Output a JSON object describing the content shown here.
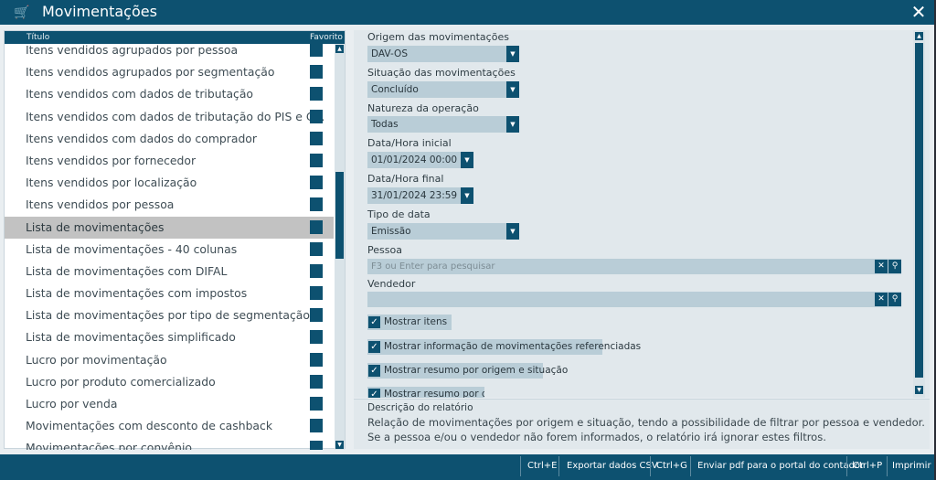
{
  "window": {
    "title": "Movimentações",
    "close_glyph": "✕",
    "logo_glyph": "🛒"
  },
  "list": {
    "header_title": "Título",
    "header_favorite": "Favorito",
    "items": [
      {
        "label": "Itens vendidos agrupados por pessoa"
      },
      {
        "label": "Itens vendidos agrupados por segmentação"
      },
      {
        "label": "Itens vendidos com dados de tributação"
      },
      {
        "label": "Itens vendidos com dados de tributação do PIS e C..."
      },
      {
        "label": "Itens vendidos com dados do comprador"
      },
      {
        "label": "Itens vendidos por fornecedor"
      },
      {
        "label": "Itens vendidos por localização"
      },
      {
        "label": "Itens vendidos por pessoa"
      },
      {
        "label": "Lista de movimentações",
        "selected": true
      },
      {
        "label": "Lista de movimentações - 40 colunas"
      },
      {
        "label": "Lista de movimentações com DIFAL"
      },
      {
        "label": "Lista de movimentações com impostos"
      },
      {
        "label": "Lista de movimentações por tipo de segmentação"
      },
      {
        "label": "Lista de movimentações simplificado"
      },
      {
        "label": "Lucro por movimentação"
      },
      {
        "label": "Lucro por produto comercializado"
      },
      {
        "label": "Lucro por venda"
      },
      {
        "label": "Movimentações com desconto de cashback"
      },
      {
        "label": "Movimentações por convênio"
      }
    ]
  },
  "filters": {
    "origem": {
      "label": "Origem das movimentações",
      "value": "DAV-OS"
    },
    "situacao": {
      "label": "Situação das movimentações",
      "value": "Concluído"
    },
    "natureza": {
      "label": "Natureza da operação",
      "value": "Todas"
    },
    "data_inicial": {
      "label": "Data/Hora inicial",
      "value": "01/01/2024 00:00"
    },
    "data_final": {
      "label": "Data/Hora final",
      "value": "31/01/2024 23:59"
    },
    "tipo_data": {
      "label": "Tipo de data",
      "value": "Emissão"
    },
    "pessoa": {
      "label": "Pessoa",
      "placeholder": "F3 ou Enter para pesquisar",
      "value": ""
    },
    "vendedor": {
      "label": "Vendedor",
      "placeholder": "",
      "value": ""
    },
    "checkboxes": [
      {
        "label": "Mostrar itens",
        "checked": true
      },
      {
        "label": "Mostrar informação de movimentações referenciadas",
        "checked": true
      },
      {
        "label": "Mostrar resumo por origem e situação",
        "checked": true
      },
      {
        "label": "Mostrar resumo por dia",
        "checked": true
      }
    ],
    "clear_glyph": "✕",
    "search_glyph": "🔍",
    "dropdown_glyph": "▼",
    "check_glyph": "✓"
  },
  "description": {
    "title": "Descrição do relatório",
    "line1": "Relação de movimentações por origem e situação, tendo a possibilidade de filtrar por pessoa e vendedor.",
    "line2": "Se a pessoa e/ou o vendedor não forem informados, o relatório irá ignorar estes filtros."
  },
  "toolbar": {
    "csv_shortcut": "Ctrl+E",
    "csv_label": "Exportar dados CSV",
    "pdf_shortcut": "Ctrl+G",
    "pdf_label": "Enviar pdf para o portal do contador",
    "print_shortcut": "Ctrl+P",
    "print_label": "Imprimir"
  },
  "colors": {
    "primary": "#0d5170",
    "field_bg": "#b9cdd7",
    "selected_row": "#c2c2c2"
  }
}
